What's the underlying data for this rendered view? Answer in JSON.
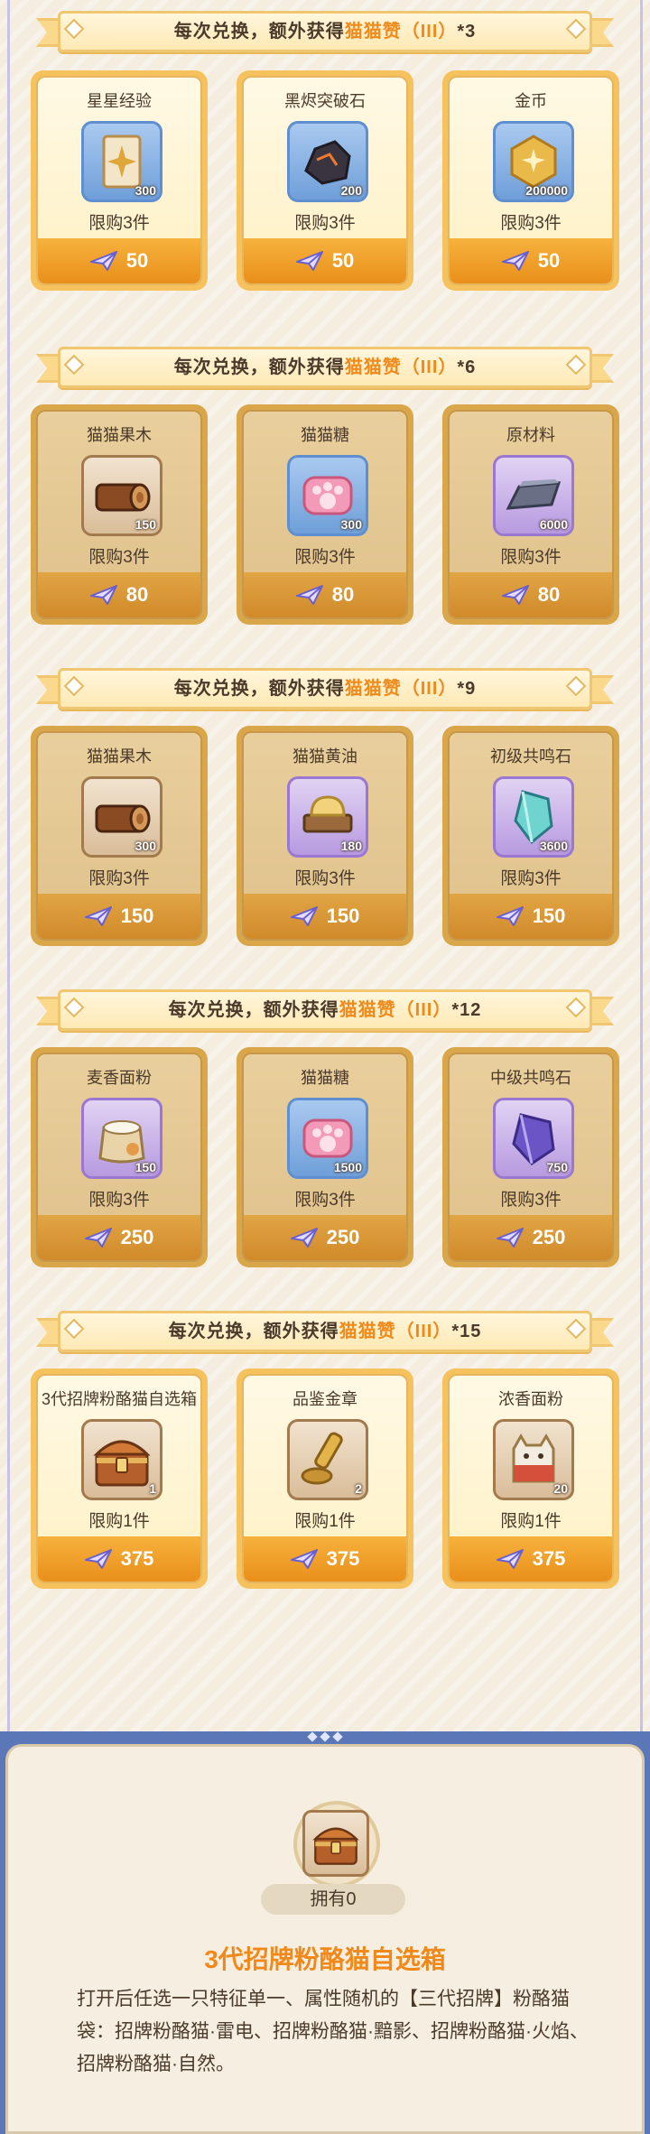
{
  "colors": {
    "accent": "#f08a1a",
    "text": "#4b3a2a",
    "price_bar": "#f6b23c",
    "panel_border": "#5c77b8"
  },
  "sections": [
    {
      "banner": {
        "prefix": "每次兑换，额外获得",
        "highlight": "猫猫赞（III）",
        "suffix": "*3"
      },
      "items": [
        {
          "name": "星星经验",
          "icon": "star-card-icon",
          "qty": "300",
          "limit": "限购3件",
          "price": "50"
        },
        {
          "name": "黑烬突破石",
          "icon": "black-ore-icon",
          "qty": "200",
          "limit": "限购3件",
          "price": "50"
        },
        {
          "name": "金币",
          "icon": "gold-coin-icon",
          "qty": "200000",
          "limit": "限购3件",
          "price": "50"
        }
      ]
    },
    {
      "banner": {
        "prefix": "每次兑换，额外获得",
        "highlight": "猫猫赞（III）",
        "suffix": "*6"
      },
      "items": [
        {
          "name": "猫猫果木",
          "icon": "log-icon",
          "qty": "150",
          "limit": "限购3件",
          "price": "80"
        },
        {
          "name": "猫猫糖",
          "icon": "paw-candy-icon",
          "qty": "300",
          "limit": "限购3件",
          "price": "80"
        },
        {
          "name": "原材料",
          "icon": "ingot-icon",
          "qty": "6000",
          "limit": "限购3件",
          "price": "80"
        }
      ]
    },
    {
      "banner": {
        "prefix": "每次兑换，额外获得",
        "highlight": "猫猫赞（III）",
        "suffix": "*9"
      },
      "items": [
        {
          "name": "猫猫果木",
          "icon": "log-icon",
          "qty": "300",
          "limit": "限购3件",
          "price": "150"
        },
        {
          "name": "猫猫黄油",
          "icon": "butter-icon",
          "qty": "180",
          "limit": "限购3件",
          "price": "150"
        },
        {
          "name": "初级共鸣石",
          "icon": "teal-crystal-icon",
          "qty": "3600",
          "limit": "限购3件",
          "price": "150"
        }
      ]
    },
    {
      "banner": {
        "prefix": "每次兑换，额外获得",
        "highlight": "猫猫赞（III）",
        "suffix": "*12"
      },
      "items": [
        {
          "name": "麦香面粉",
          "icon": "flour-sack-icon",
          "qty": "150",
          "limit": "限购3件",
          "price": "250"
        },
        {
          "name": "猫猫糖",
          "icon": "paw-candy-icon",
          "qty": "1500",
          "limit": "限购3件",
          "price": "250"
        },
        {
          "name": "中级共鸣石",
          "icon": "purple-crystal-icon",
          "qty": "750",
          "limit": "限购3件",
          "price": "250"
        }
      ]
    },
    {
      "banner": {
        "prefix": "每次兑换，额外获得",
        "highlight": "猫猫赞（III）",
        "suffix": "*15"
      },
      "items": [
        {
          "name": "3代招牌粉酪猫自选箱",
          "icon": "chest-icon",
          "qty": "1",
          "limit": "限购1件",
          "price": "375"
        },
        {
          "name": "品鉴金章",
          "icon": "gold-stamp-icon",
          "qty": "2",
          "limit": "限购1件",
          "price": "375"
        },
        {
          "name": "浓香面粉",
          "icon": "cat-bag-icon",
          "qty": "20",
          "limit": "限购1件",
          "price": "375"
        }
      ]
    }
  ],
  "detail": {
    "own_label": "拥有0",
    "title": "3代招牌粉酪猫自选箱",
    "description": "打开后任选一只特征单一、属性随机的【三代招牌】粉酪猫袋：招牌粉酪猫·雷电、招牌粉酪猫·黯影、招牌粉酪猫·火焰、招牌粉酪猫·自然。"
  }
}
